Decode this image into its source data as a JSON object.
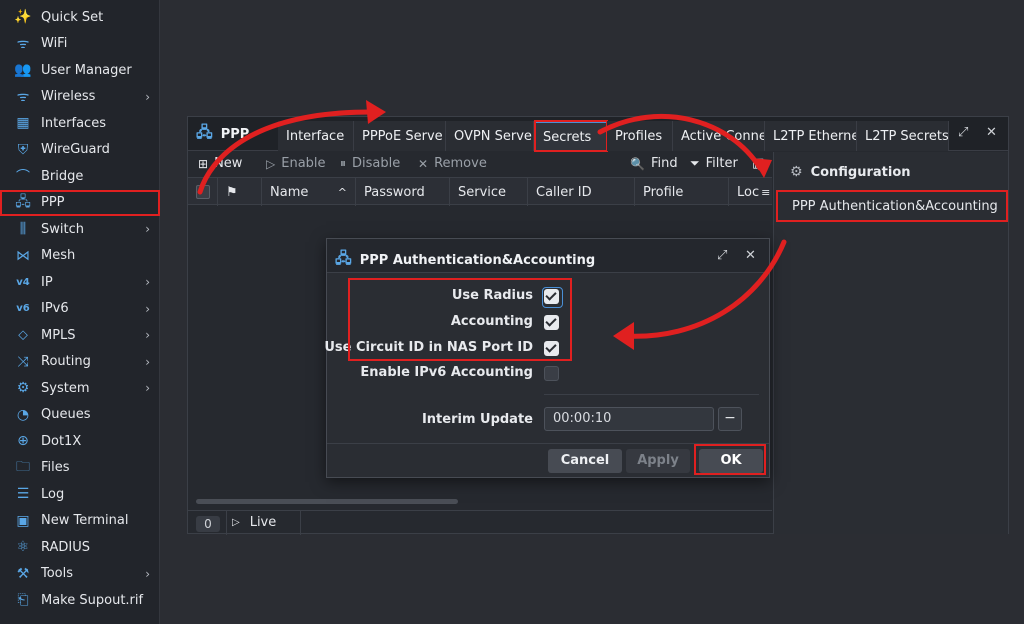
{
  "sidebar": {
    "items": [
      {
        "label": "Quick Set",
        "icon": "wand-icon",
        "glyph": "✨",
        "chevron": false
      },
      {
        "label": "WiFi",
        "icon": "wifi-icon",
        "glyph": "ᯤ",
        "chevron": false
      },
      {
        "label": "User Manager",
        "icon": "users-icon",
        "glyph": "👥",
        "chevron": false
      },
      {
        "label": "Wireless",
        "icon": "wireless-icon",
        "glyph": "ᯤ",
        "chevron": true
      },
      {
        "label": "Interfaces",
        "icon": "interfaces-icon",
        "glyph": "▦",
        "chevron": false
      },
      {
        "label": "WireGuard",
        "icon": "wireguard-icon",
        "glyph": "⛨",
        "chevron": false
      },
      {
        "label": "Bridge",
        "icon": "bridge-icon",
        "glyph": "⌒",
        "chevron": false
      },
      {
        "label": "PPP",
        "icon": "ppp-icon",
        "glyph": "🖧",
        "chevron": false,
        "active": true
      },
      {
        "label": "Switch",
        "icon": "switch-icon",
        "glyph": "⫼",
        "chevron": true
      },
      {
        "label": "Mesh",
        "icon": "mesh-icon",
        "glyph": "⋈",
        "chevron": false
      },
      {
        "label": "IP",
        "icon": "ip-icon",
        "glyph": "v4",
        "chevron": true
      },
      {
        "label": "IPv6",
        "icon": "ipv6-icon",
        "glyph": "v6",
        "chevron": true
      },
      {
        "label": "MPLS",
        "icon": "mpls-icon",
        "glyph": "⬦",
        "chevron": true
      },
      {
        "label": "Routing",
        "icon": "routing-icon",
        "glyph": "⤨",
        "chevron": true
      },
      {
        "label": "System",
        "icon": "gear-icon",
        "glyph": "⚙",
        "chevron": true
      },
      {
        "label": "Queues",
        "icon": "queues-icon",
        "glyph": "◔",
        "chevron": false
      },
      {
        "label": "Dot1X",
        "icon": "dot1x-icon",
        "glyph": "⊕",
        "chevron": false
      },
      {
        "label": "Files",
        "icon": "folder-icon",
        "glyph": "🗀",
        "chevron": false
      },
      {
        "label": "Log",
        "icon": "log-icon",
        "glyph": "☰",
        "chevron": false
      },
      {
        "label": "New Terminal",
        "icon": "terminal-icon",
        "glyph": "▣",
        "chevron": false
      },
      {
        "label": "RADIUS",
        "icon": "radius-icon",
        "glyph": "⚛",
        "chevron": false
      },
      {
        "label": "Tools",
        "icon": "tools-icon",
        "glyph": "⚒",
        "chevron": true
      },
      {
        "label": "Make Supout.rif",
        "icon": "supout-icon",
        "glyph": "⎗",
        "chevron": false
      }
    ]
  },
  "ppp_window": {
    "title": "PPP",
    "tabs": [
      "Interface",
      "PPPoE Serve",
      "OVPN Server",
      "Secrets",
      "Profiles",
      "Active Conne",
      "L2TP Etherne",
      "L2TP Secrets"
    ],
    "active_tab": "Secrets",
    "toolbar": {
      "new": "New",
      "enable": "Enable",
      "disable": "Disable",
      "remove": "Remove",
      "find": "Find",
      "filter": "Filter"
    },
    "columns": [
      "Name",
      "Password",
      "Service",
      "Caller ID",
      "Profile",
      "Loc"
    ],
    "row_count": "0",
    "live": "Live",
    "side_panel": {
      "title": "Configuration",
      "link": "PPP Authentication&Accounting"
    }
  },
  "dialog": {
    "title": "PPP Authentication&Accounting",
    "fields": [
      {
        "label": "Use Radius",
        "checked": true
      },
      {
        "label": "Accounting",
        "checked": true
      },
      {
        "label": "Use Circuit ID in NAS Port ID",
        "checked": true
      },
      {
        "label": "Enable IPv6 Accounting",
        "checked": false
      }
    ],
    "interim_label": "Interim Update",
    "interim_value": "00:00:10",
    "minus": "−",
    "buttons": {
      "cancel": "Cancel",
      "apply": "Apply",
      "ok": "OK"
    }
  },
  "colors": {
    "accent": "#5aa7e6",
    "annotation": "#e02020"
  }
}
